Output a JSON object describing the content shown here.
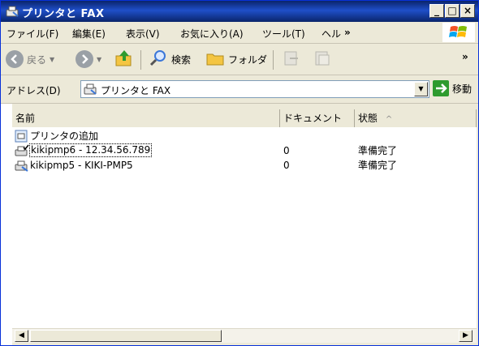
{
  "window": {
    "title": "プリンタと FAX",
    "min": "_",
    "max": "□",
    "close": "×"
  },
  "menubar": {
    "items": [
      "ファイル(F)",
      "編集(E)",
      "表示(V)",
      "お気に入り(A)",
      "ツール(T)",
      "ヘル"
    ],
    "overflow": "»"
  },
  "toolbar": {
    "back": "戻る",
    "search": "検索",
    "folders": "フォルダ",
    "overflow": "»"
  },
  "address": {
    "label": "アドレス(D)",
    "value": "プリンタと FAX",
    "go": "移動"
  },
  "list": {
    "columns": [
      "名前",
      "ドキュメント",
      "状態"
    ],
    "rows": [
      {
        "name": "プリンタの追加",
        "docs": "",
        "status": ""
      },
      {
        "name": "kikipmp6 - 12.34.56.789",
        "docs": "0",
        "status": "準備完了"
      },
      {
        "name": "kikipmp5 - KIKI-PMP5",
        "docs": "0",
        "status": "準備完了"
      }
    ],
    "sort_indicator": "^"
  },
  "colors": {
    "title_bar": "#0a246a",
    "window_bg": "#ece9d8",
    "go_green": "#2e9b2e"
  }
}
